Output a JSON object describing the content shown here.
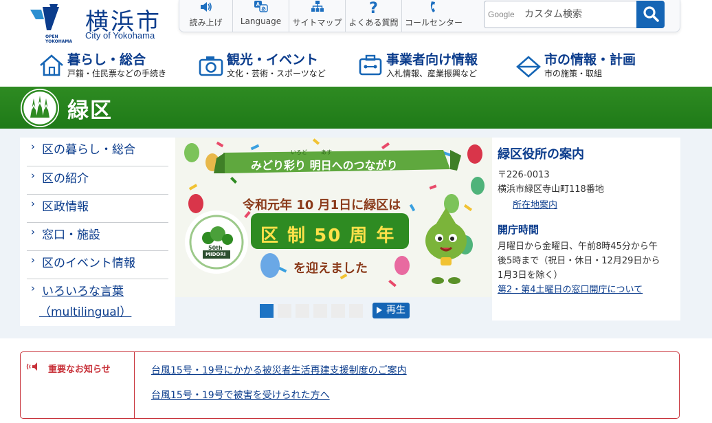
{
  "header": {
    "logo_small": "OPEN\nYOKOHAMA",
    "logo_jp": "横浜市",
    "logo_en": "City of Yokohama",
    "tools": [
      {
        "label": "読み上げ",
        "icon": "speaker-icon"
      },
      {
        "label": "Language",
        "icon": "language-icon"
      },
      {
        "label": "サイトマップ",
        "icon": "sitemap-icon"
      },
      {
        "label": "よくある質問",
        "icon": "question-icon"
      },
      {
        "label": "コールセンター",
        "icon": "phone-icon"
      }
    ],
    "search": {
      "google": "Google",
      "placeholder": "カスタム検索"
    }
  },
  "gnav": [
    {
      "title": "暮らし・総合",
      "sub": "戸籍・住民票などの手続き",
      "icon": "house-icon"
    },
    {
      "title": "観光・イベント",
      "sub": "文化・芸術・スポーツなど",
      "icon": "camera-icon"
    },
    {
      "title": "事業者向け情報",
      "sub": "入札情報、産業振興など",
      "icon": "business-icon"
    },
    {
      "title": "市の情報・計画",
      "sub": "市の施策・取組",
      "icon": "diamond-icon"
    }
  ],
  "ward": {
    "name": "緑区"
  },
  "sidemenu": [
    {
      "label": "区の暮らし・総合"
    },
    {
      "label": "区の紹介"
    },
    {
      "label": "区政情報"
    },
    {
      "label": "窓口・施設"
    },
    {
      "label": "区のイベント情報"
    },
    {
      "label": "いろいろな言葉",
      "label2": "（multilingual）"
    }
  ],
  "slide": {
    "ribbon": "みどり彩り 明日へのつながり",
    "ruby1": "いろど",
    "ruby2": "あす",
    "line1": "令和元年 10 月1日に緑区は",
    "big": "区 制 50 周 年",
    "line3": "を迎えました",
    "badge_top": "50th",
    "badge_bottom": "MIDORI"
  },
  "carousel": {
    "count": 6,
    "active": 1,
    "play_label": "再生"
  },
  "office": {
    "title": "緑区役所の案内",
    "postal": "〒226-0013",
    "address": "横浜市緑区寺山町118番地",
    "map_link": "所在地案内",
    "hours_title": "開庁時間",
    "hours_1": "月曜日から金曜日、午前8時45分から午",
    "hours_2": "後5時まで（祝日・休日・12月29日から",
    "hours_3": "1月3日を除く）",
    "saturday_link": "第2・第4土曜日の窓口開庁について"
  },
  "notice": {
    "title": "重要なお知らせ",
    "links": [
      "台風15号・19号にかかる被災者生活再建支援制度のご案内",
      "台風15号・19号で被害を受けられた方へ"
    ]
  },
  "colors": {
    "brand_blue": "#0b3c8c",
    "ward_green": "#2e8b22",
    "alert_red": "#c8323a",
    "button_blue": "#1565b5"
  }
}
